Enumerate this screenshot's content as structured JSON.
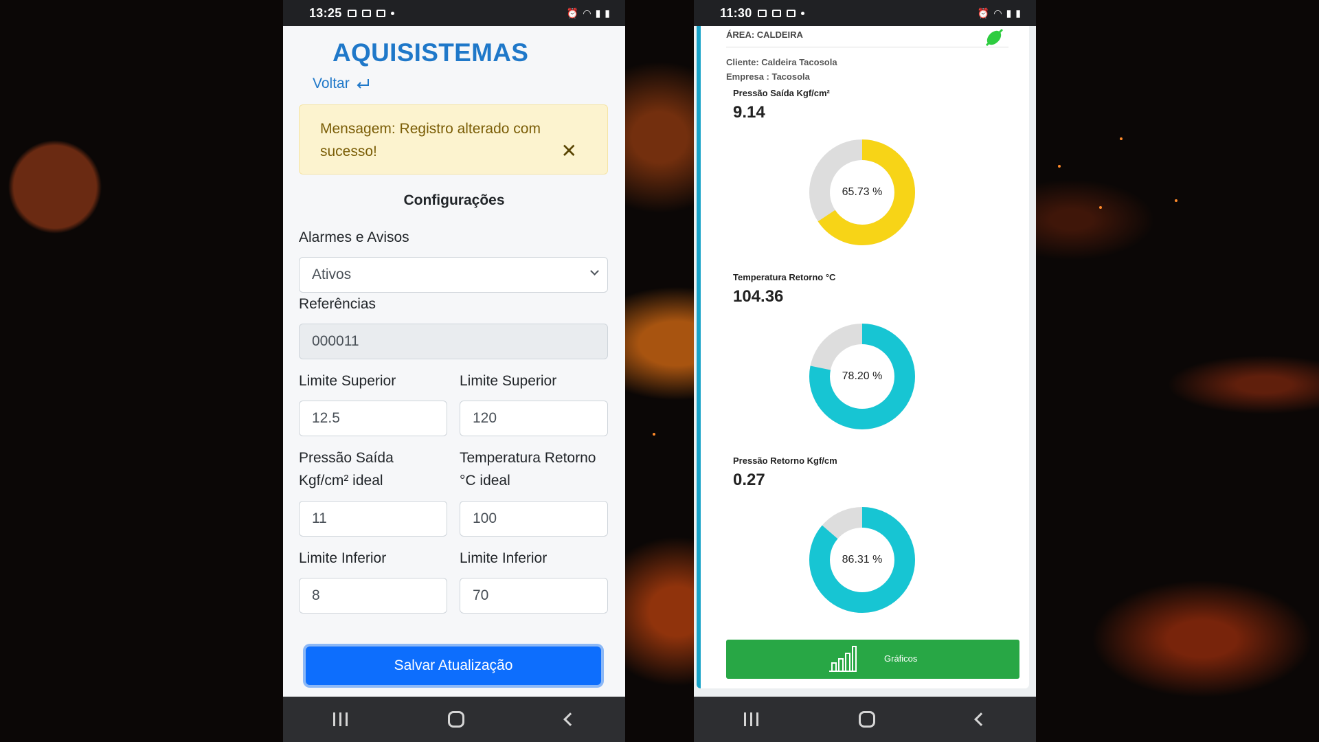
{
  "left_phone": {
    "status": {
      "time": "13:25"
    },
    "brand": "AQUISISTEMAS",
    "back_label": "Voltar",
    "alert": {
      "text": "Mensagem: Registro alterado com sucesso!"
    },
    "section_title": "Configurações",
    "alarms": {
      "label": "Alarmes e Avisos",
      "value": "Ativos"
    },
    "references": {
      "label": "Referências",
      "value": "000011"
    },
    "col1": {
      "limit_sup_label": "Limite Superior",
      "limit_sup_value": "12.5",
      "ideal_label_1": "Pressão Saída",
      "ideal_label_2": "Kgf/cm² ideal",
      "ideal_value": "11",
      "limit_inf_label": "Limite Inferior",
      "limit_inf_value": "8"
    },
    "col2": {
      "limit_sup_label": "Limite Superior",
      "limit_sup_value": "120",
      "ideal_label_1": "Temperatura Retorno",
      "ideal_label_2": "°C ideal",
      "ideal_value": "100",
      "limit_inf_label": "Limite Inferior",
      "limit_inf_value": "70"
    },
    "save_label": "Salvar Atualização"
  },
  "right_phone": {
    "status": {
      "time": "11:30"
    },
    "area": "ÁREA: CALDEIRA",
    "client": "Cliente: Caldeira Tacosola",
    "company": "Empresa : Tacosola",
    "metrics": [
      {
        "label": "Pressão Saída Kgf/cm²",
        "value": "9.14",
        "percent": 65.73,
        "percent_text": "65.73 %",
        "color": "#f7d417"
      },
      {
        "label": "Temperatura Retorno °C",
        "value": "104.36",
        "percent": 78.2,
        "percent_text": "78.20 %",
        "color": "#17c5d3"
      },
      {
        "label": "Pressão Retorno Kgf/cm",
        "value": "0.27",
        "percent": 86.31,
        "percent_text": "86.31 %",
        "color": "#17c5d3"
      }
    ],
    "graph_label": "Gráficos",
    "colors": {
      "accent": "#19a3c8",
      "button": "#28a745",
      "track": "#dddddd"
    }
  }
}
